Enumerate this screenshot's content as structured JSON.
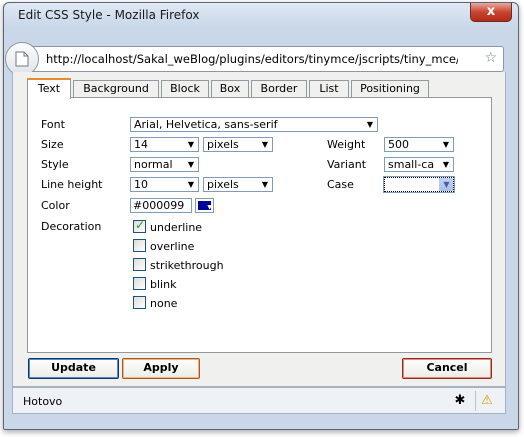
{
  "window": {
    "title": "Edit CSS Style - Mozilla Firefox",
    "close_label": "x"
  },
  "urlbar": {
    "url": "http://localhost/Sakal_weBlog/plugins/editors/tinymce/jscripts/tiny_mce/plu"
  },
  "tabs": [
    "Text",
    "Background",
    "Block",
    "Box",
    "Border",
    "List",
    "Positioning"
  ],
  "active_tab": "Text",
  "form": {
    "font": {
      "label": "Font",
      "value": "Arial, Helvetica, sans-serif"
    },
    "size": {
      "label": "Size",
      "value": "14",
      "unit": "pixels"
    },
    "weight": {
      "label": "Weight",
      "value": "500"
    },
    "style": {
      "label": "Style",
      "value": "normal"
    },
    "variant": {
      "label": "Variant",
      "value": "small-ca"
    },
    "line_height": {
      "label": "Line height",
      "value": "10",
      "unit": "pixels"
    },
    "case": {
      "label": "Case",
      "value": ""
    },
    "color": {
      "label": "Color",
      "value": "#000099"
    },
    "decoration": {
      "label": "Decoration",
      "options": [
        {
          "label": "underline",
          "checked": true
        },
        {
          "label": "overline",
          "checked": false
        },
        {
          "label": "strikethrough",
          "checked": false
        },
        {
          "label": "blink",
          "checked": false
        },
        {
          "label": "none",
          "checked": false
        }
      ]
    }
  },
  "buttons": {
    "update": "Update",
    "apply": "Apply",
    "cancel": "Cancel"
  },
  "status": {
    "text": "Hotovo"
  }
}
